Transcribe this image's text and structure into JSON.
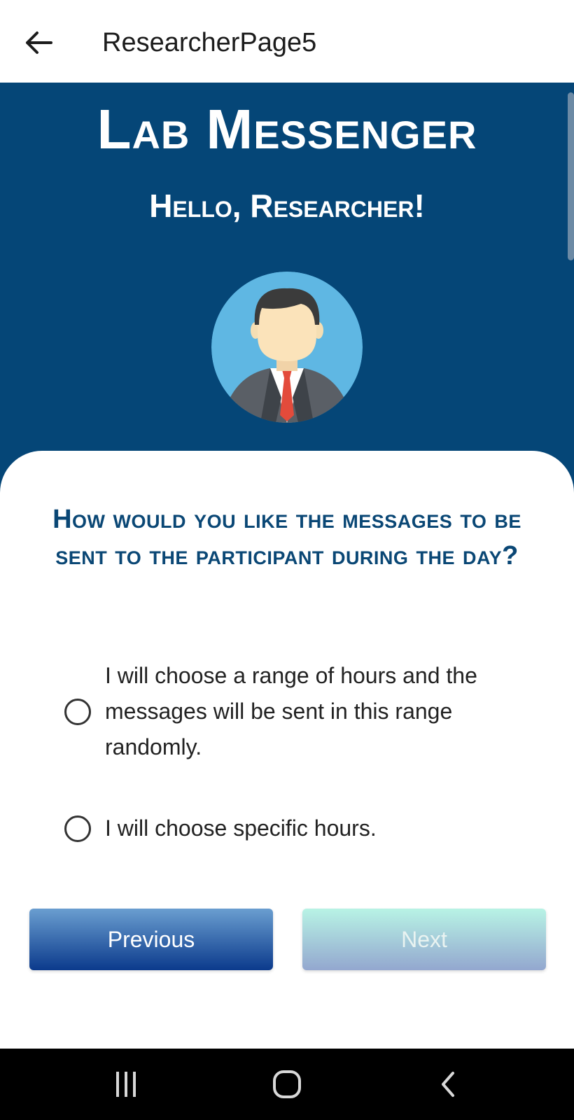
{
  "appbar": {
    "title": "ResearcherPage5",
    "back_icon": "arrow-left-icon"
  },
  "hero": {
    "brand": "Lab Messenger",
    "greeting": "Hello, Researcher!",
    "background_color": "#054677",
    "avatar_icon": "researcher-avatar-icon"
  },
  "question": {
    "text": "How would you like the messages to be sent to the participant during the day?"
  },
  "options": [
    {
      "label": "I will choose a range of hours and the messages will be sent in this range randomly.",
      "selected": false
    },
    {
      "label": "I will choose specific hours.",
      "selected": false
    }
  ],
  "buttons": {
    "previous_label": "Previous",
    "next_label": "Next",
    "next_enabled": false
  },
  "system_nav": {
    "recents_icon": "recents-icon",
    "home_icon": "home-icon",
    "back_icon": "back-chevron-icon"
  },
  "colors": {
    "accent": "#0a4775",
    "primary_button": "#0b3a8c"
  }
}
